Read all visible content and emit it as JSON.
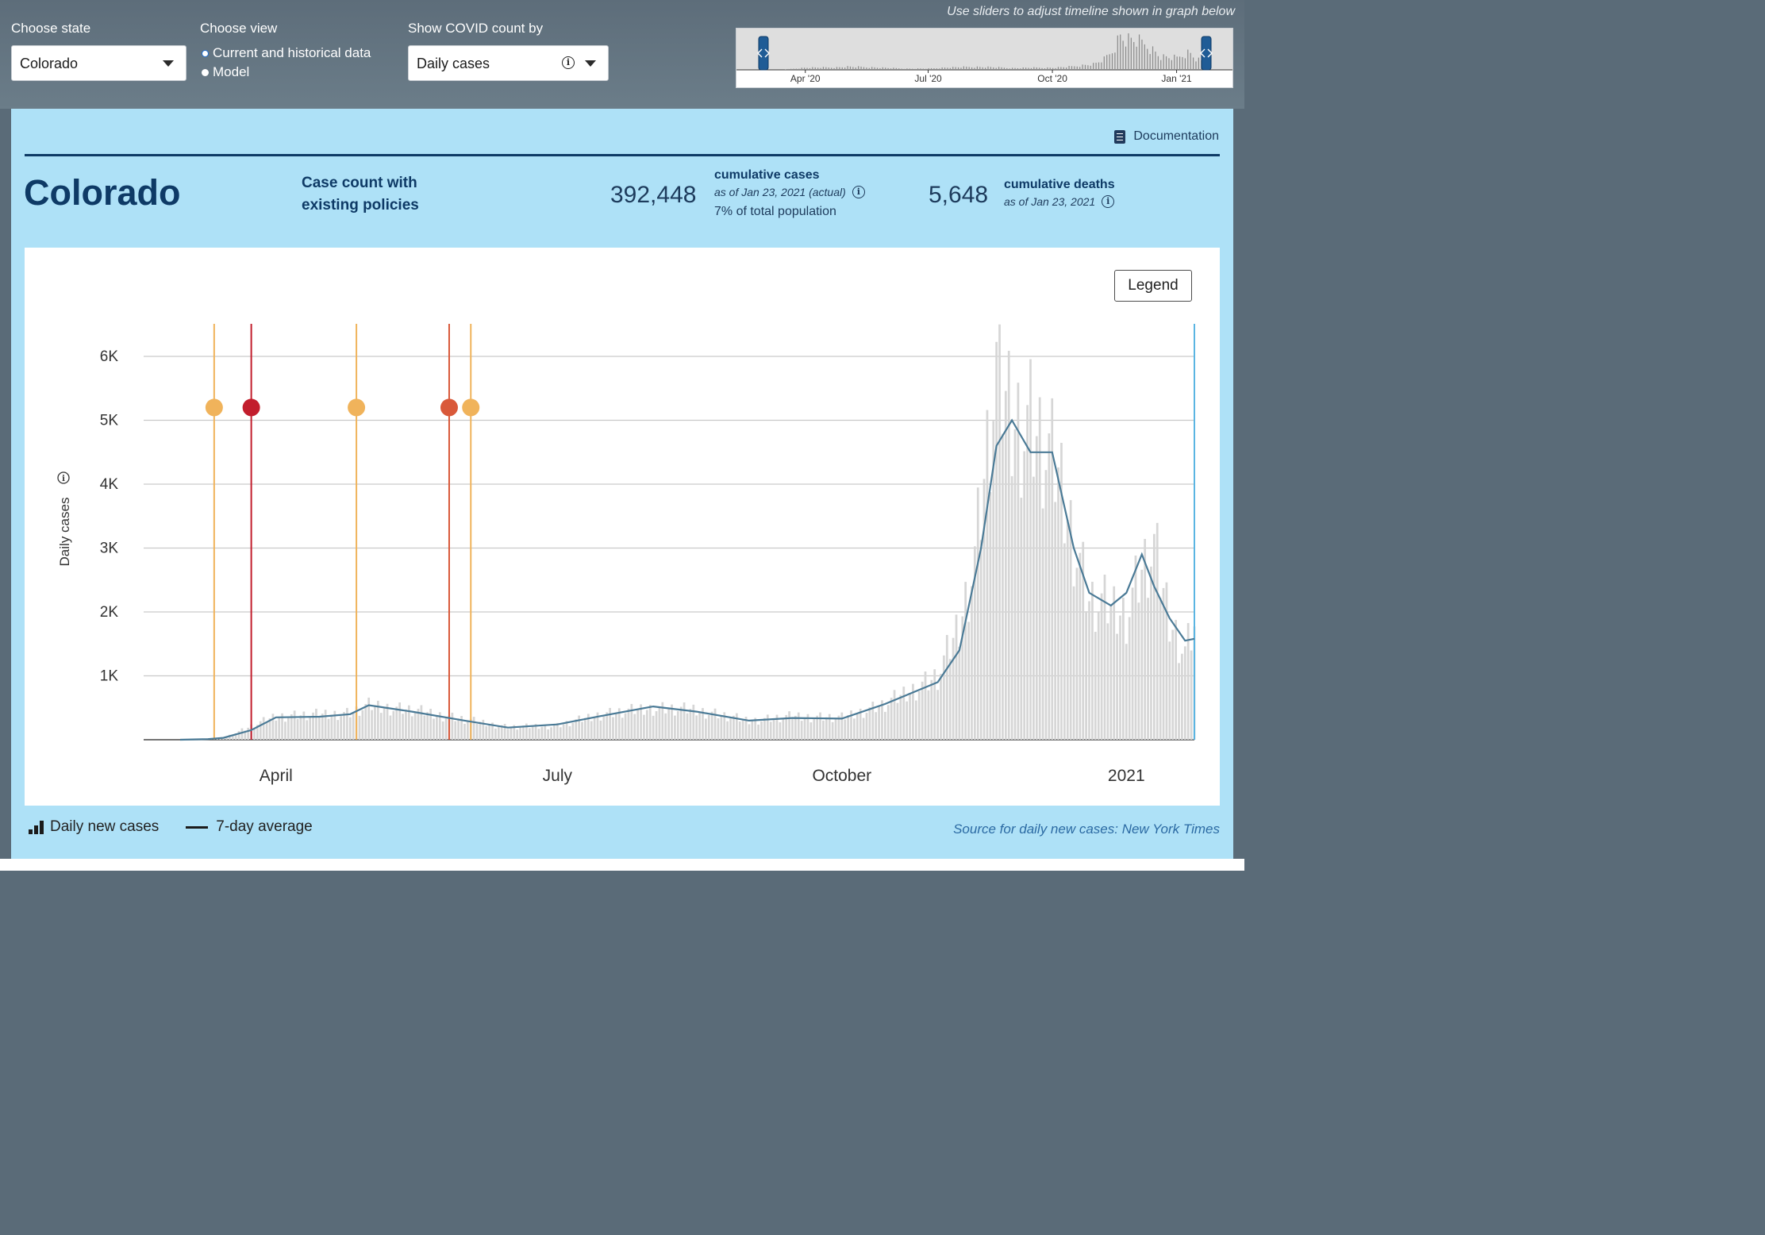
{
  "controls": {
    "state_label": "Choose state",
    "state_value": "Colorado",
    "view_label": "Choose view",
    "view_options": [
      "Current and historical data",
      "Model"
    ],
    "view_selected": "Current and historical data",
    "count_label": "Show COVID count by",
    "count_value": "Daily cases",
    "slider_note": "Use sliders to adjust timeline shown in graph below",
    "mini_ticks": [
      "Apr '20",
      "Jul '20",
      "Oct '20",
      "Jan '21"
    ]
  },
  "panel": {
    "documentation": "Documentation",
    "state_title": "Colorado",
    "case_label_line1": "Case count with",
    "case_label_line2": "existing policies",
    "cumulative_cases_value": "392,448",
    "cumulative_cases_label": "cumulative cases",
    "cumulative_cases_date": "as of Jan 23, 2021 (actual)",
    "cumulative_cases_pct": "7% of total population",
    "cumulative_deaths_value": "5,648",
    "cumulative_deaths_label": "cumulative deaths",
    "cumulative_deaths_date": "as of Jan 23, 2021",
    "legend_button": "Legend",
    "footer_daily": "Daily new cases",
    "footer_avg": "7-day average",
    "source": "Source for daily new cases: New York Times"
  },
  "colors": {
    "panel_bg": "#aee1f7",
    "navy": "#0e3a66",
    "bar": "#d6d6d6",
    "avg_line": "#4a7a96",
    "policy_orange": "#f0b35b",
    "policy_red": "#c21d2c",
    "policy_redorange": "#d9593a",
    "today_line": "#5bb5e2"
  },
  "chart_data": {
    "type": "bar",
    "ylabel": "Daily cases",
    "yticks": [
      "1K",
      "2K",
      "3K",
      "4K",
      "5K",
      "6K"
    ],
    "ylim": [
      0,
      6500
    ],
    "xticks": [
      "April",
      "July",
      "October",
      "2021"
    ],
    "x_range": [
      "2020-03-01",
      "2021-01-23"
    ],
    "policy_markers": [
      {
        "date": "2020-03-12",
        "color": "orange"
      },
      {
        "date": "2020-03-24",
        "color": "red"
      },
      {
        "date": "2020-04-27",
        "color": "orange"
      },
      {
        "date": "2020-05-27",
        "color": "red-orange"
      },
      {
        "date": "2020-06-03",
        "color": "orange"
      }
    ],
    "series": [
      {
        "name": "Daily new cases",
        "kind": "bars",
        "x": [
          "2020-03-01",
          "2020-03-15",
          "2020-04-01",
          "2020-04-15",
          "2020-04-25",
          "2020-05-01",
          "2020-05-15",
          "2020-06-01",
          "2020-06-15",
          "2020-07-01",
          "2020-07-15",
          "2020-08-01",
          "2020-08-15",
          "2020-09-01",
          "2020-09-15",
          "2020-10-01",
          "2020-10-15",
          "2020-11-01",
          "2020-11-08",
          "2020-11-13",
          "2020-11-20",
          "2020-11-25",
          "2020-12-01",
          "2020-12-10",
          "2020-12-20",
          "2021-01-01",
          "2021-01-06",
          "2021-01-10",
          "2021-01-15",
          "2021-01-20",
          "2021-01-23"
        ],
        "values": [
          0,
          30,
          370,
          400,
          420,
          540,
          470,
          320,
          200,
          220,
          400,
          500,
          470,
          300,
          370,
          350,
          560,
          1000,
          1800,
          2900,
          5800,
          5100,
          5000,
          4200,
          2200,
          2000,
          2700,
          3000,
          1900,
          1400,
          1800
        ]
      },
      {
        "name": "7-day average",
        "kind": "line",
        "x": [
          "2020-03-01",
          "2020-03-10",
          "2020-03-15",
          "2020-03-24",
          "2020-04-01",
          "2020-04-15",
          "2020-04-25",
          "2020-05-01",
          "2020-05-15",
          "2020-06-01",
          "2020-06-15",
          "2020-07-01",
          "2020-07-15",
          "2020-08-01",
          "2020-08-15",
          "2020-09-01",
          "2020-09-15",
          "2020-10-01",
          "2020-10-15",
          "2020-11-01",
          "2020-11-08",
          "2020-11-15",
          "2020-11-20",
          "2020-11-25",
          "2020-12-01",
          "2020-12-08",
          "2020-12-15",
          "2020-12-20",
          "2020-12-27",
          "2021-01-01",
          "2021-01-06",
          "2021-01-10",
          "2021-01-15",
          "2021-01-20",
          "2021-01-23"
        ],
        "values": [
          0,
          10,
          30,
          150,
          350,
          360,
          400,
          540,
          440,
          300,
          190,
          240,
          370,
          520,
          440,
          300,
          340,
          330,
          560,
          900,
          1400,
          3000,
          4600,
          5000,
          4500,
          4500,
          3000,
          2300,
          2100,
          2300,
          2900,
          2400,
          1900,
          1550,
          1580
        ]
      }
    ]
  }
}
